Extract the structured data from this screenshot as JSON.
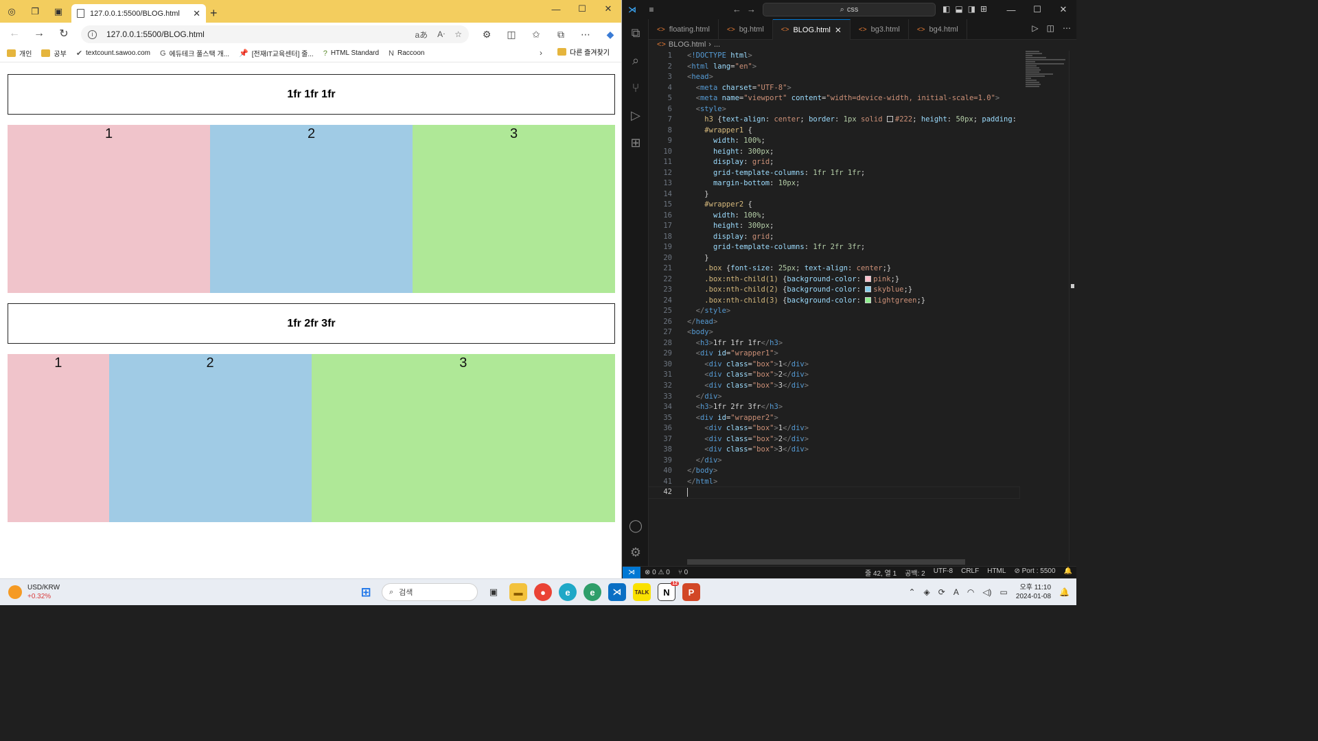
{
  "browser": {
    "tab_title": "127.0.0.1:5500/BLOG.html",
    "address": "127.0.0.1:5500/BLOG.html",
    "read_aloud_label": "aあ",
    "bookmarks": [
      {
        "label": "개인",
        "icon": "folder-icon"
      },
      {
        "label": "공부",
        "icon": "folder-icon"
      },
      {
        "label": "textcount.sawoo.com",
        "icon": "check-icon"
      },
      {
        "label": "에듀테크 풀스택 개...",
        "icon": "google-icon"
      },
      {
        "label": "[전재IT교육센터] 줄...",
        "icon": "pin-icon"
      },
      {
        "label": "HTML Standard",
        "icon": "question-icon"
      },
      {
        "label": "Raccoon",
        "icon": "notion-icon"
      }
    ],
    "other_bookmarks": "다른 즐겨찾기",
    "page": {
      "heading1": "1fr 1fr 1fr",
      "heading2": "1fr 2fr 3fr",
      "wrapper1": [
        "1",
        "2",
        "3"
      ],
      "wrapper2": [
        "1",
        "2",
        "3"
      ]
    }
  },
  "vscode": {
    "search_text": "css",
    "tabs": [
      {
        "label": "floating.html",
        "active": false
      },
      {
        "label": "bg.html",
        "active": false
      },
      {
        "label": "BLOG.html",
        "active": true
      },
      {
        "label": "bg3.html",
        "active": false
      },
      {
        "label": "bg4.html",
        "active": false
      }
    ],
    "breadcrumb": [
      "BLOG.html",
      "..."
    ],
    "status": {
      "errors": "0",
      "warnings": "0",
      "ports": "0",
      "position": "줄 42, 열 1",
      "spaces": "공백: 2",
      "encoding": "UTF-8",
      "eol": "CRLF",
      "language": "HTML",
      "port": "Port : 5500"
    },
    "current_line": 42
  },
  "taskbar": {
    "ticker": "USD/KRW",
    "change": "+0.32%",
    "search_placeholder": "검색",
    "time": "오후 11:10",
    "date": "2024-01-08",
    "notification_count": "12"
  }
}
